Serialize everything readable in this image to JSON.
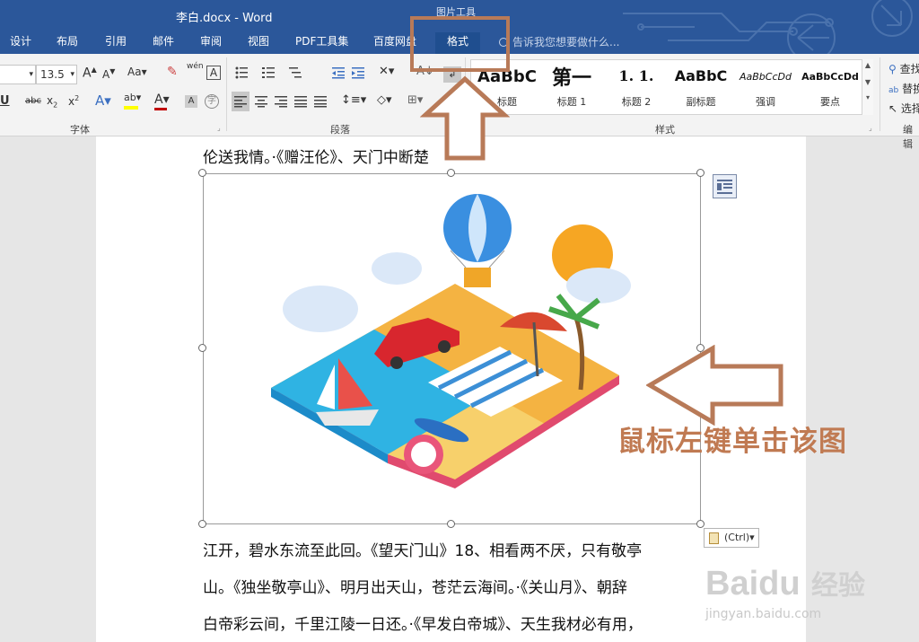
{
  "window": {
    "title": "李白.docx - Word",
    "context_group": "图片工具"
  },
  "tabs": [
    "设计",
    "布局",
    "引用",
    "邮件",
    "审阅",
    "视图",
    "PDF工具集",
    "百度网盘",
    "格式"
  ],
  "active_tab": "格式",
  "tell_me": {
    "placeholder": "告诉我您想要做什么..."
  },
  "ribbon": {
    "font_size": "13.5",
    "groups": {
      "font": "字体",
      "paragraph": "段落",
      "styles": "样式",
      "editing": "编辑"
    },
    "styles": [
      {
        "sample": "AaBbC",
        "name": "标题"
      },
      {
        "sample": "第一",
        "name": "标题 1"
      },
      {
        "sample": "1. 1.",
        "name": "标题 2"
      },
      {
        "sample": "AaBbC",
        "name": "副标题"
      },
      {
        "sample": "AaBbCcDd",
        "name": "强调"
      },
      {
        "sample": "AaBbCcDd",
        "name": "要点"
      }
    ],
    "right_cmds": [
      "查找",
      "替换",
      "选择"
    ],
    "phonetic_label": "wén",
    "font_color": "#c00000",
    "highlight_color": "#ffff00"
  },
  "document": {
    "line_top": "伦送我情。·《赠汪伦》、天门中断楚",
    "lines_bottom": [
      "江开，碧水东流至此回。《望天门山》18、相看两不厌，只有敬亭",
      "山。《独坐敬亭山》、明月出天山，苍茫云海间。·《关山月》、朝辞",
      "白帝彩云间，千里江陵一日还。·《早发白帝城》、天生我材必有用，"
    ],
    "paste_options": "(Ctrl)▾"
  },
  "annotation": {
    "text": "鼠标左键单击该图",
    "color": "#c07a52"
  },
  "watermark": {
    "brand": "Baidu",
    "suffix": "经验",
    "url": "jingyan.baidu.com"
  },
  "colors": {
    "title_bar": "#2b579a",
    "ribbon": "#f3f3f3",
    "annotation_box": "#b87a58"
  }
}
